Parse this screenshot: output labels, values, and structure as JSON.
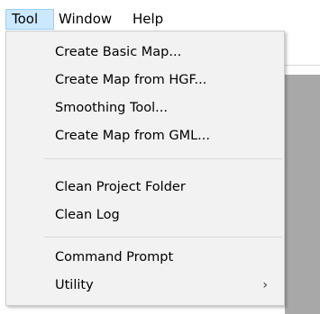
{
  "menubar": {
    "items": [
      {
        "label": "Tool",
        "active": true
      },
      {
        "label": "Window"
      },
      {
        "label": "Help"
      }
    ]
  },
  "tool_menu": {
    "groups": [
      [
        "Create Basic Map...",
        "Create Map from HGF...",
        "Smoothing Tool...",
        "Create Map from GML..."
      ],
      [
        "Clean Project Folder",
        "Clean Log"
      ],
      [
        "Command Prompt",
        "Utility"
      ]
    ],
    "submenu_indicator": "›",
    "highlight_color": "#cce8ff",
    "background_color": "#f2f2f2"
  }
}
